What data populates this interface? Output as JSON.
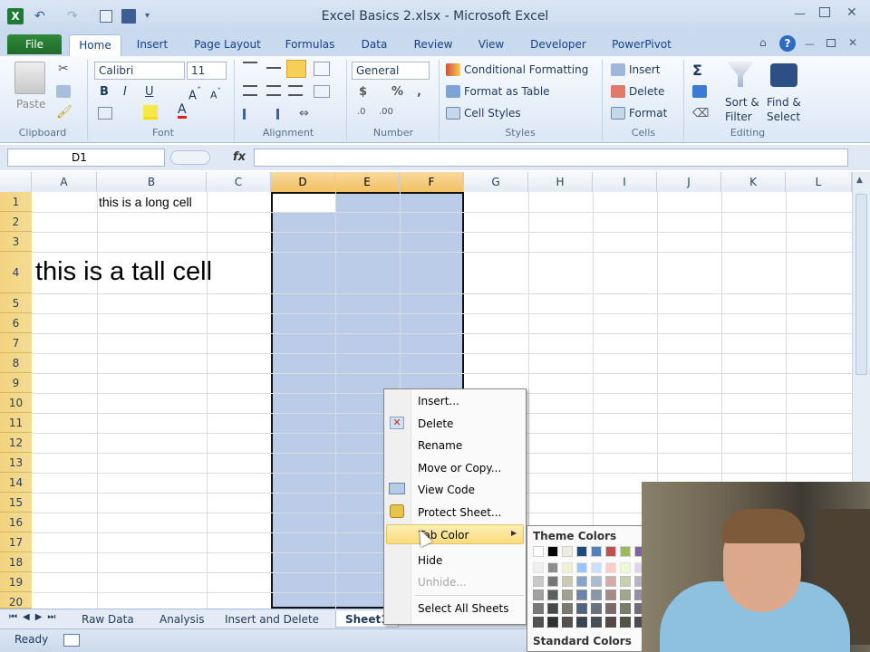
{
  "window": {
    "title": "Excel Basics 2.xlsx - Microsoft Excel"
  },
  "ribbon_tabs": [
    "File",
    "Home",
    "Insert",
    "Page Layout",
    "Formulas",
    "Data",
    "Review",
    "View",
    "Developer",
    "PowerPivot"
  ],
  "ribbon": {
    "clipboard": {
      "paste": "Paste",
      "label": "Clipboard"
    },
    "font": {
      "name": "Calibri",
      "size": "11",
      "label": "Font"
    },
    "alignment": {
      "label": "Alignment"
    },
    "number": {
      "format": "General",
      "label": "Number"
    },
    "styles": {
      "conditional": "Conditional Formatting",
      "format_table": "Format as Table",
      "cell_styles": "Cell Styles",
      "label": "Styles"
    },
    "cells": {
      "insert": "Insert",
      "delete": "Delete",
      "format": "Format",
      "label": "Cells"
    },
    "editing": {
      "sort": "Sort &",
      "filter": "Filter",
      "find": "Find &",
      "select": "Select",
      "label": "Editing"
    }
  },
  "name_box": "D1",
  "fx": "fx",
  "columns": [
    "A",
    "B",
    "C",
    "D",
    "E",
    "F",
    "G",
    "H",
    "I",
    "J",
    "K",
    "L"
  ],
  "rows": [
    "1",
    "2",
    "3",
    "4",
    "5",
    "6",
    "7",
    "8",
    "9",
    "10",
    "11",
    "12",
    "13",
    "14",
    "15",
    "16",
    "17",
    "18",
    "19",
    "20"
  ],
  "cells": {
    "B1": "this is a long cell",
    "A4": "this is a tall cell"
  },
  "sheet_tabs": [
    "Raw Data",
    "Analysis",
    "Insert and Delete",
    "Sheet1"
  ],
  "status": "Ready",
  "context_menu": [
    "Insert...",
    "Delete",
    "Rename",
    "Move or Copy...",
    "View Code",
    "Protect Sheet...",
    "Tab Color",
    "Hide",
    "Unhide...",
    "Select All Sheets"
  ],
  "tab_color_submenu": {
    "theme": "Theme Colors",
    "standard": "Standard Colors"
  },
  "colors": {
    "accent_green": "#217346",
    "selection": "#bacce8",
    "header_selected": "#f4c868"
  }
}
